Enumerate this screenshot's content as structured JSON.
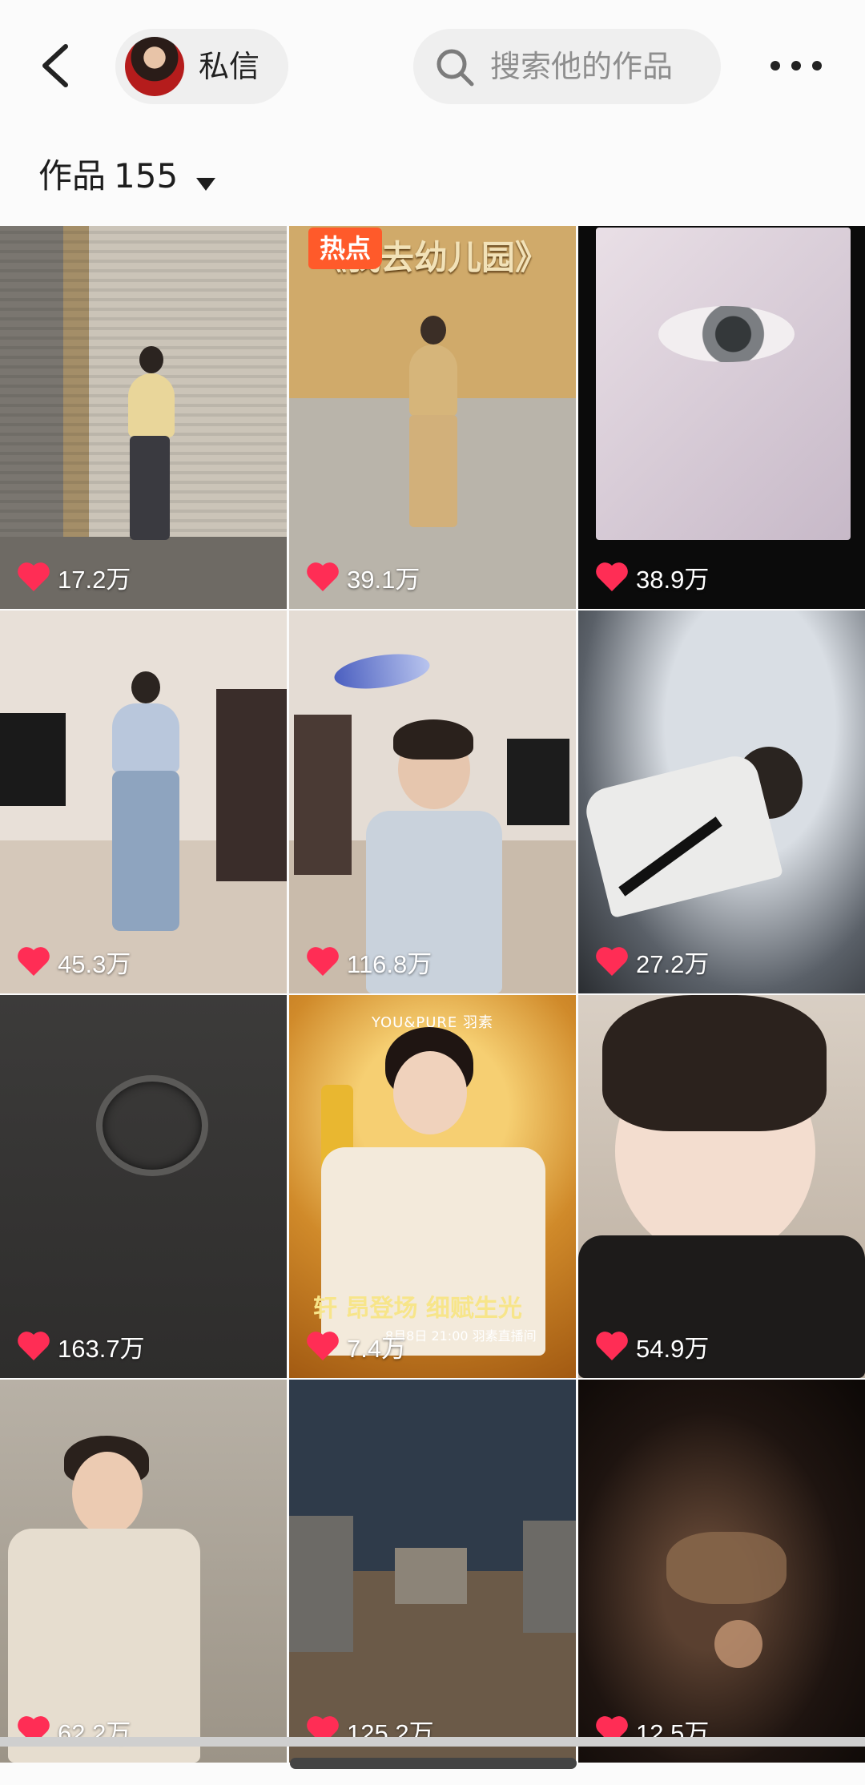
{
  "header": {
    "message_label": "私信",
    "search_placeholder": "搜索他的作品"
  },
  "works": {
    "label": "作品",
    "count": "155"
  },
  "icons": {
    "back": "back-arrow-icon",
    "search": "search-icon",
    "more": "more-dots-icon",
    "caret": "caret-down-icon",
    "like": "heart-icon"
  },
  "colors": {
    "like_heart": "#ff2d55",
    "hot_badge": "#ff5a2a"
  },
  "videos": [
    {
      "likes": "17.2万"
    },
    {
      "likes": "39.1万",
      "badge": "热点",
      "caption": "《我去幼儿园》"
    },
    {
      "likes": "38.9万"
    },
    {
      "likes": "45.3万"
    },
    {
      "likes": "116.8万"
    },
    {
      "likes": "27.2万"
    },
    {
      "likes": "163.7万"
    },
    {
      "likes": "7.4万",
      "brand": "YOU&PURE 羽素",
      "slogan": "轩 昂登场 细赋生光",
      "date": "8月8日 21:00 羽素直播间"
    },
    {
      "likes": "54.9万"
    },
    {
      "likes": "62.2万"
    },
    {
      "likes": "125.2万"
    },
    {
      "likes": "12.5万"
    }
  ]
}
